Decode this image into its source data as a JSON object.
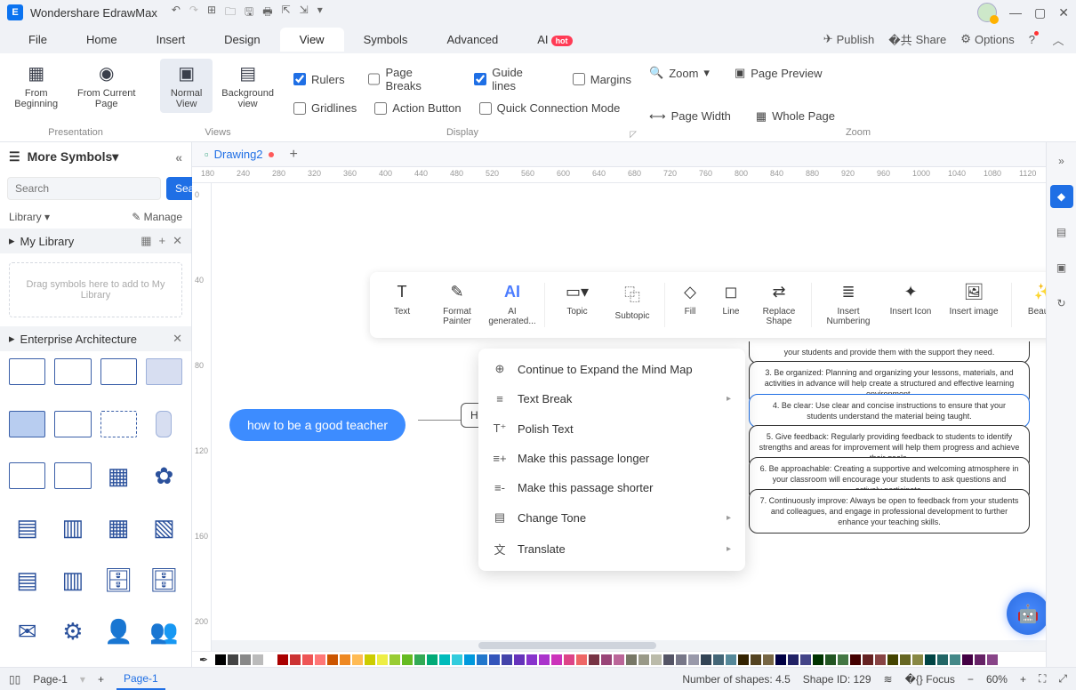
{
  "app": {
    "title": "Wondershare EdrawMax"
  },
  "menus": {
    "file": "File",
    "home": "Home",
    "insert": "Insert",
    "design": "Design",
    "view": "View",
    "symbols": "Symbols",
    "advanced": "Advanced",
    "ai": "AI",
    "ai_badge": "hot"
  },
  "menu_right": {
    "publish": "Publish",
    "share": "Share",
    "options": "Options"
  },
  "ribbon": {
    "presentation": {
      "label": "Presentation",
      "from_beginning": "From Beginning",
      "from_current": "From Current Page"
    },
    "views": {
      "label": "Views",
      "normal": "Normal View",
      "background": "Background view"
    },
    "display": {
      "label": "Display",
      "rulers": "Rulers",
      "page_breaks": "Page Breaks",
      "guide_lines": "Guide lines",
      "margins": "Margins",
      "gridlines": "Gridlines",
      "action_button": "Action Button",
      "quick_conn": "Quick Connection Mode"
    },
    "zoom": {
      "label": "Zoom",
      "zoom": "Zoom",
      "page_preview": "Page Preview",
      "page_width": "Page Width",
      "whole_page": "Whole Page"
    }
  },
  "left": {
    "more": "More Symbols",
    "search_ph": "Search",
    "search_btn": "Search",
    "library": "Library",
    "manage": "Manage",
    "mylib": "My Library",
    "drop": "Drag symbols here to add to My Library",
    "ea": "Enterprise Architecture"
  },
  "tab": {
    "name": "Drawing2"
  },
  "ruler_h": [
    "180",
    "240",
    "280",
    "320",
    "360",
    "400",
    "440",
    "480",
    "520",
    "560",
    "600",
    "640",
    "680",
    "720",
    "760",
    "800",
    "840",
    "880",
    "920",
    "960",
    "1000",
    "1040",
    "1080",
    "1120"
  ],
  "ruler_v": [
    "0",
    "40",
    "80",
    "120",
    "160",
    "200"
  ],
  "mindmap": {
    "center": "how to be a good teacher",
    "hbox": "He",
    "branches": [
      "3. Be organized: Planning and organizing your lessons, materials, and activities in advance will help create a structured and effective learning environment.",
      "4. Be clear: Use clear and concise instructions to ensure that your students understand the material being taught.",
      "5. Give feedback: Regularly providing feedback to students to identify strengths and areas for improvement will help them progress and achieve their goals.",
      "6. Be approachable: Creating a supportive and welcoming atmosphere in your classroom will encourage your students to ask questions and actively participate.",
      "7. Continuously improve: Always be open to feedback from your students and colleagues, and engage in professional development to further enhance your teaching skills."
    ],
    "branch_tail": "your students and provide them with the support they need."
  },
  "float": {
    "text": "Text",
    "format": "Format Painter",
    "ai": "AI generated...",
    "topic": "Topic",
    "subtopic": "Subtopic",
    "fill": "Fill",
    "line": "Line",
    "replace": "Replace Shape",
    "numbering": "Insert Numbering",
    "icon": "Insert Icon",
    "image": "Insert image",
    "beautify": "Beautify"
  },
  "ctx": {
    "expand": "Continue to Expand the Mind Map",
    "tbreak": "Text Break",
    "polish": "Polish Text",
    "longer": "Make this passage longer",
    "shorter": "Make this passage shorter",
    "tone": "Change Tone",
    "translate": "Translate"
  },
  "status": {
    "page": "Page-1",
    "page_tab": "Page-1",
    "shapes": "Number of shapes: 4.5",
    "shape_id": "Shape ID: 129",
    "focus": "Focus",
    "zoom": "60%"
  },
  "colors": [
    "#000",
    "#444",
    "#888",
    "#bbb",
    "#fff",
    "#a00",
    "#c33",
    "#e55",
    "#f77",
    "#c50",
    "#e82",
    "#fb5",
    "#cc0",
    "#ee4",
    "#9c3",
    "#6b2",
    "#3a5",
    "#0a7",
    "#0bb",
    "#3cd",
    "#09d",
    "#27c",
    "#35b",
    "#44a",
    "#63b",
    "#83c",
    "#a3c",
    "#c3b",
    "#d48",
    "#e66",
    "#734",
    "#947",
    "#b69",
    "#776",
    "#998",
    "#bba",
    "#556",
    "#778",
    "#99a",
    "#345",
    "#467",
    "#589",
    "#320",
    "#542",
    "#764",
    "#004",
    "#226",
    "#448",
    "#030",
    "#252",
    "#474",
    "#400",
    "#622",
    "#844",
    "#440",
    "#662",
    "#884",
    "#044",
    "#266",
    "#488",
    "#404",
    "#626",
    "#848"
  ]
}
